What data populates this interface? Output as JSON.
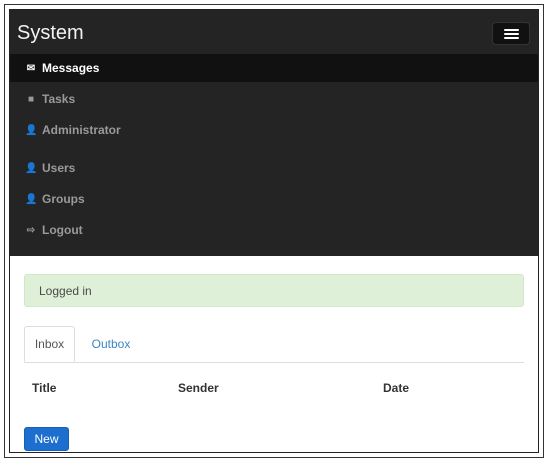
{
  "navbar": {
    "brand": "System",
    "items": [
      {
        "label": "Messages",
        "icon": "envelope-icon",
        "glyph": "✉",
        "active": true
      },
      {
        "label": "Tasks",
        "icon": "folder-icon",
        "glyph": "■",
        "active": false
      },
      {
        "label": "Administrator",
        "icon": "user-icon",
        "glyph": "👤",
        "active": false
      },
      {
        "label": "Users",
        "icon": "user-icon",
        "glyph": "👤",
        "active": false
      },
      {
        "label": "Groups",
        "icon": "user-icon",
        "glyph": "👤",
        "active": false
      },
      {
        "label": "Logout",
        "icon": "logout-icon",
        "glyph": "⇨",
        "active": false
      }
    ]
  },
  "alert": {
    "text": "Logged in"
  },
  "tabs": [
    {
      "label": "Inbox",
      "active": true
    },
    {
      "label": "Outbox",
      "active": false
    }
  ],
  "table": {
    "columns": [
      "Title",
      "Sender",
      "Date"
    ]
  },
  "actions": {
    "new_label": "New"
  },
  "colors": {
    "navbar_bg": "#242424",
    "active_item_bg": "#111111",
    "alert_bg": "#dff0d8",
    "link": "#3a86c8",
    "primary_button": "#1d6fcf"
  }
}
